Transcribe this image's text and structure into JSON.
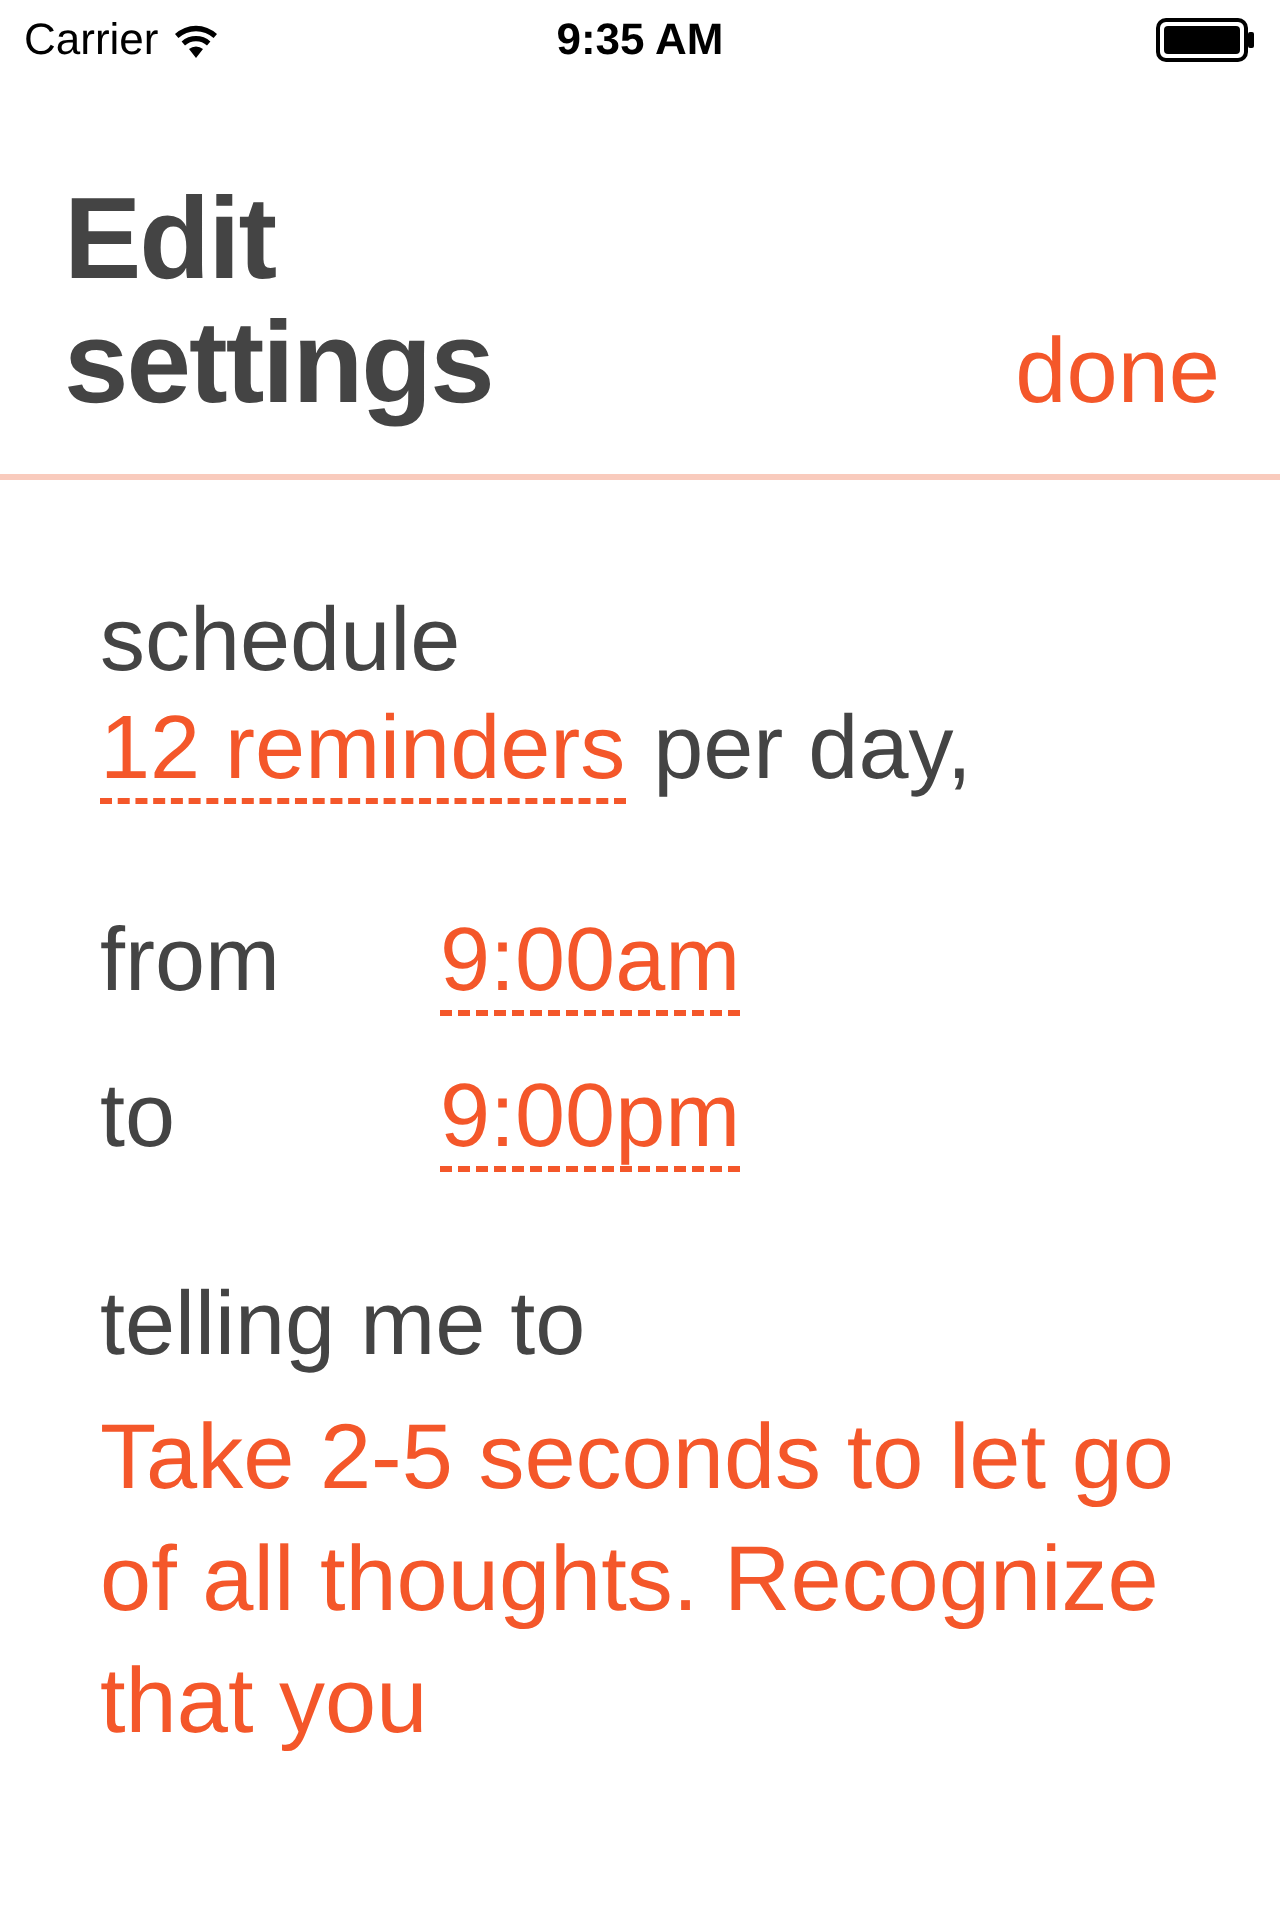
{
  "status_bar": {
    "carrier": "Carrier",
    "time": "9:35 AM"
  },
  "header": {
    "title": "Edit settings",
    "done": "done"
  },
  "schedule": {
    "label": "schedule",
    "count": "12 reminders",
    "suffix": "per day,"
  },
  "times": [
    {
      "label": "from",
      "value": "9:00am"
    },
    {
      "label": "to",
      "value": "9:00pm"
    }
  ],
  "message": {
    "label": "telling me to",
    "text": "Take 2-5 seconds to let go of all thoughts. Recognize that you"
  }
}
